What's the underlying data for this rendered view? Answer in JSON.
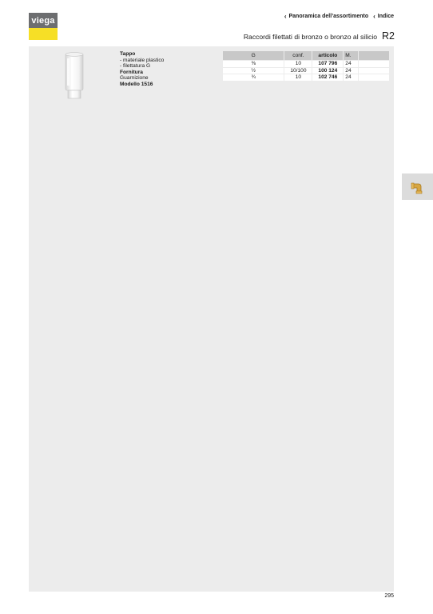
{
  "brand": {
    "logo_text": "viega"
  },
  "nav": {
    "overview_label": "Panoramica dell’assortimento",
    "index_label": "Indice"
  },
  "header": {
    "subtitle": "Raccordi filettati di bronzo o bronzo al silicio",
    "code": "R2"
  },
  "product": {
    "name": "Tappo",
    "features": [
      "- materiale plastico",
      "- filettatura G"
    ],
    "supply_heading": "Fornitura",
    "supply_item": "Guarnizione",
    "model": "Modello 1516",
    "image_icon": "plastic-plug-image"
  },
  "table": {
    "headers": {
      "g": "G",
      "conf": "conf.",
      "articolo": "articolo",
      "m": "M."
    },
    "rows": [
      {
        "g": "⅜",
        "conf": "10",
        "articolo": "107 796",
        "m": "24"
      },
      {
        "g": "½",
        "conf": "10/100",
        "articolo": "100 124",
        "m": "24"
      },
      {
        "g": "¾",
        "conf": "10",
        "articolo": "102 746",
        "m": "24"
      }
    ]
  },
  "side_tab": {
    "icon": "brass-fitting-icon"
  },
  "footer": {
    "page_number": "295"
  },
  "colors": {
    "logo_gray": "#6d6e70",
    "logo_yellow": "#f6df26",
    "panel_bg": "#ececec",
    "table_header_bg": "#c8c8c8"
  }
}
